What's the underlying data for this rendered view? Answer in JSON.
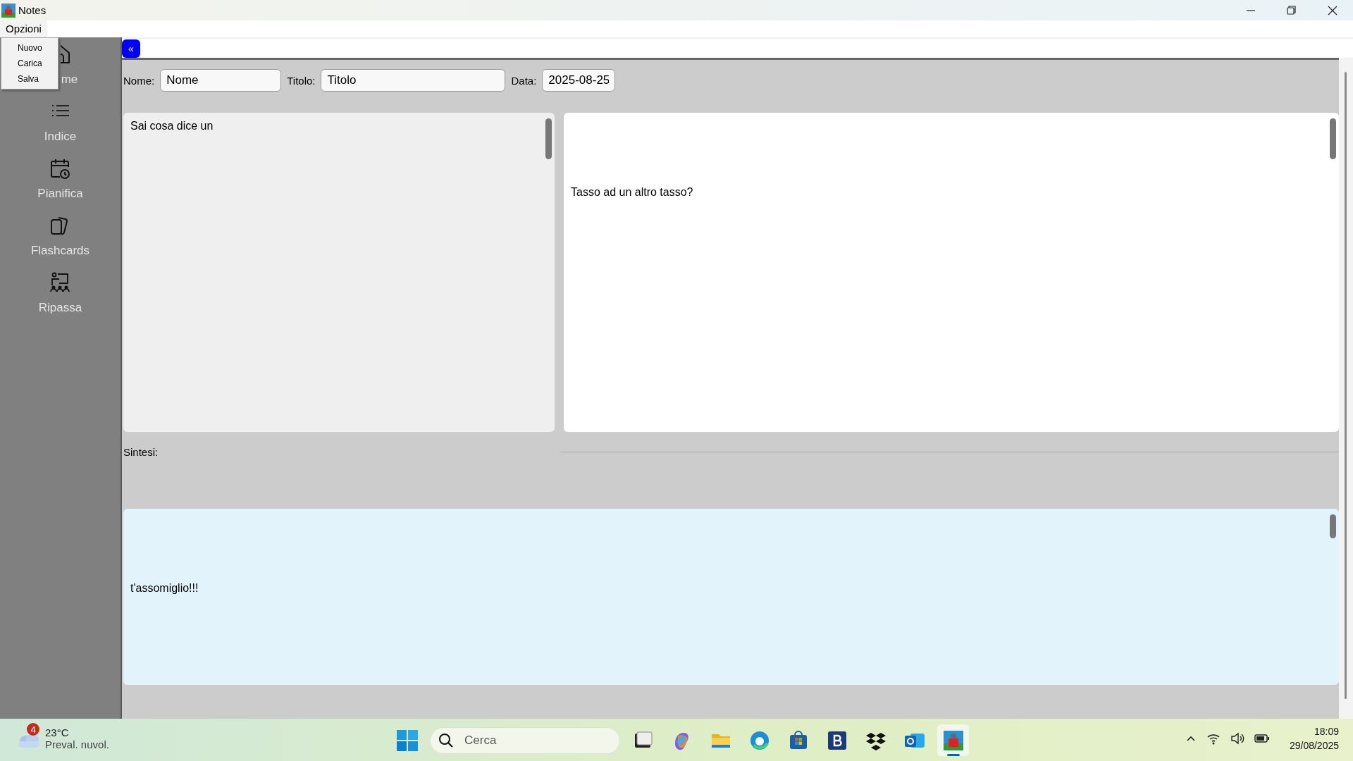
{
  "window": {
    "title": "Notes"
  },
  "menu_bar": {
    "items": [
      {
        "label": "Opzioni",
        "expanded": true,
        "entries": [
          "Nuovo",
          "Carica",
          "Salva"
        ]
      }
    ]
  },
  "sidebar": {
    "items": [
      {
        "label": "me"
      },
      {
        "label": "Indice"
      },
      {
        "label": "Pianifica"
      },
      {
        "label": "Flashcards"
      },
      {
        "label": "Ripassa"
      }
    ]
  },
  "collapse_button": "«",
  "fields": [
    {
      "label": "Nome:",
      "value": "Nome"
    },
    {
      "label": "Titolo:",
      "value": "Titolo"
    },
    {
      "label": "Data:",
      "value": "2025-08-25"
    }
  ],
  "notes": {
    "front": "Sai cosa dice un",
    "back": "Tasso ad un altro tasso?"
  },
  "summary": {
    "label": "Sintesi:",
    "text": "t'assomiglio!!!"
  },
  "taskbar": {
    "weather": {
      "badge": "4",
      "temperature": "23°C",
      "condition": "Preval. nuvol."
    },
    "search": {
      "placeholder": "Cerca"
    },
    "apps": [
      {
        "selected": false
      },
      {
        "selected": false
      },
      {
        "selected": false
      },
      {
        "selected": false
      },
      {
        "selected": false
      },
      {
        "selected": false
      },
      {
        "selected": false
      },
      {
        "selected": false
      },
      {
        "selected": true
      }
    ],
    "time": "18:09",
    "date": "29/08/2025"
  }
}
